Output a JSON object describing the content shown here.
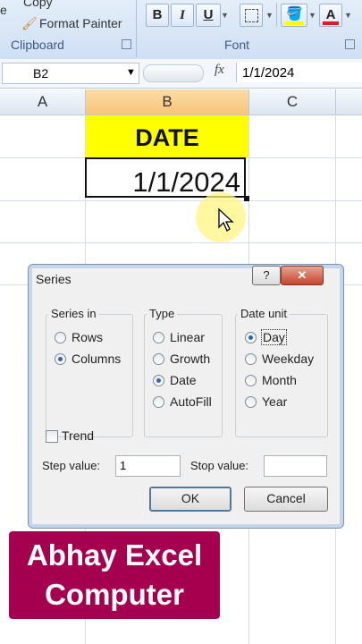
{
  "ribbon": {
    "copy_label": "Copy",
    "format_painter_label": "Format Painter",
    "clipboard_group": "Clipboard",
    "font_group": "Font",
    "bold_label": "B",
    "italic_label": "I",
    "underline_label": "U",
    "font_color_label": "A",
    "cut_fragment": "e"
  },
  "formula_bar": {
    "name_box": "B2",
    "fx_label": "fx",
    "formula": "1/1/2024"
  },
  "columns": [
    "A",
    "B",
    "C"
  ],
  "cells": {
    "b1": "DATE",
    "b2": "1/1/2024"
  },
  "dialog": {
    "title": "Series",
    "help_label": "?",
    "close_label": "✕",
    "series_in": {
      "label": "Series in",
      "options": [
        "Rows",
        "Columns"
      ],
      "selected": "Columns"
    },
    "type": {
      "label": "Type",
      "options": [
        "Linear",
        "Growth",
        "Date",
        "AutoFill"
      ],
      "selected": "Date"
    },
    "date_unit": {
      "label": "Date unit",
      "options": [
        "Day",
        "Weekday",
        "Month",
        "Year"
      ],
      "selected": "Day"
    },
    "trend_label": "Trend",
    "step_label": "Step value:",
    "step_value": "1",
    "stop_label": "Stop value:",
    "stop_value": "",
    "ok_label": "OK",
    "cancel_label": "Cancel"
  },
  "watermark": {
    "line1": "Abhay Excel",
    "line2": "Computer"
  },
  "colors": {
    "header_fill": "#ffff00",
    "watermark_bg": "#a50050",
    "selected_col": "#f9c985"
  }
}
